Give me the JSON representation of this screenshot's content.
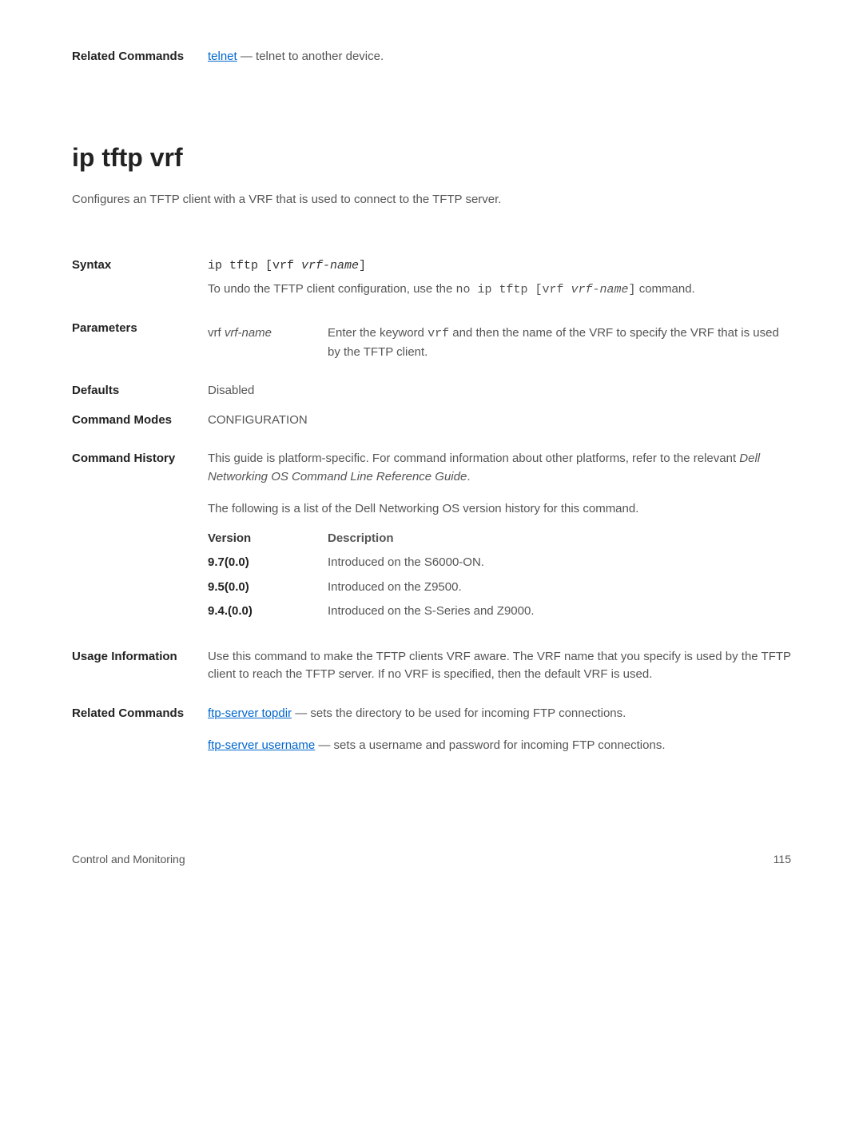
{
  "top": {
    "related_label": "Related Commands",
    "telnet_link": "telnet",
    "telnet_desc": " — telnet to another device."
  },
  "section": {
    "title": "ip tftp vrf",
    "description": "Configures an TFTP client with a VRF that is used to connect to the TFTP server."
  },
  "syntax": {
    "label": "Syntax",
    "command_prefix": "ip tftp [vrf ",
    "command_var": "vrf-name",
    "command_suffix": "]",
    "undo_prefix": "To undo the TFTP client configuration, use the ",
    "undo_cmd_prefix": "no ip tftp [vrf ",
    "undo_cmd_var": "vrf-name",
    "undo_cmd_suffix": "]",
    "undo_after": " command."
  },
  "parameters": {
    "label": "Parameters",
    "param_name_prefix": "vrf ",
    "param_name_var": "vrf-name",
    "param_desc_prefix": "Enter the keyword ",
    "param_desc_kw": "vrf",
    "param_desc_suffix": " and then the name of the VRF to specify the VRF that is used by the TFTP client."
  },
  "defaults": {
    "label": "Defaults",
    "value": "Disabled"
  },
  "command_modes": {
    "label": "Command Modes",
    "value": "CONFIGURATION"
  },
  "history": {
    "label": "Command History",
    "intro_prefix": "This guide is platform-specific. For command information about other platforms, refer to the relevant ",
    "intro_italic": "Dell Networking OS Command Line Reference Guide",
    "intro_suffix": ".",
    "list_intro": "The following is a list of the Dell Networking OS version history for this command.",
    "version_header": "Version",
    "description_header": "Description",
    "rows": [
      {
        "version": "9.7(0.0)",
        "description": "Introduced on the S6000-ON."
      },
      {
        "version": "9.5(0.0)",
        "description": "Introduced on the Z9500."
      },
      {
        "version": "9.4.(0.0)",
        "description": "Introduced on the S-Series and Z9000."
      }
    ]
  },
  "usage": {
    "label": "Usage Information",
    "text": "Use this command to make the TFTP clients VRF aware. The VRF name that you specify is used by the TFTP client to reach the TFTP server. If no VRF is specified, then the default VRF is used."
  },
  "related": {
    "label": "Related Commands",
    "link1": "ftp-server topdir",
    "desc1": " — sets the directory to be used for incoming FTP connections.",
    "link2": "ftp-server username",
    "desc2": " — sets a username and password for incoming FTP connections."
  },
  "footer": {
    "left": "Control and Monitoring",
    "right": "115"
  }
}
